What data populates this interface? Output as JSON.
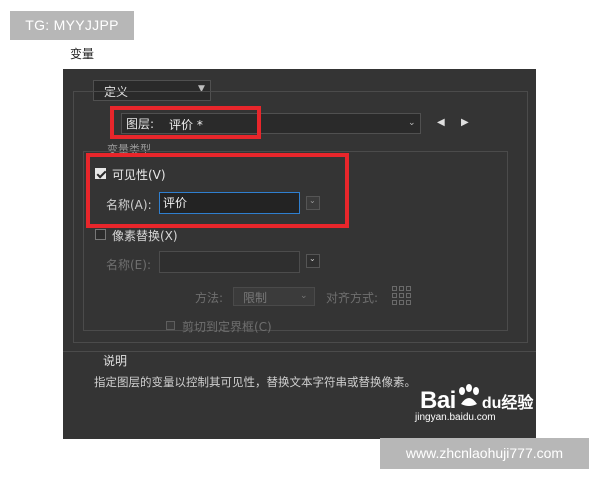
{
  "watermarks": {
    "top_left_tag": "TG: MYYJJPP",
    "baidu_text": "Bai",
    "baidu_text2": "du",
    "baidu_cn": "经验",
    "baidu_url": "jingyan.baidu.com",
    "site": "www.zhcnlaohuji777.com"
  },
  "page": {
    "title": "变量"
  },
  "dialog": {
    "define_select": {
      "value": "定义"
    },
    "layer": {
      "label": "图层:",
      "value": "评价 *"
    },
    "variable_type_label": "变量类型",
    "visibility": {
      "label": "可见性(V)",
      "checked": true,
      "name_label": "名称(A):",
      "name_value": "评价"
    },
    "pixel_replace": {
      "label": "像素替换(X)",
      "checked": false,
      "name_label": "名称(E):",
      "name_value": ""
    },
    "method": {
      "label": "方法:",
      "value": "限制",
      "align_label": "对齐方式:"
    },
    "clip": {
      "label": "剪切到定界框(C)",
      "checked": false
    },
    "description": {
      "header": "说明",
      "text": "指定图层的变量以控制其可见性，替换文本字符串或替换像素。"
    }
  },
  "colors": {
    "dialog_bg": "#343434",
    "highlight_red": "#e8262b",
    "focus_blue": "#2f7fcf",
    "badge_gray": "#b7b7b7"
  },
  "icons": [
    "chevron-down-icon",
    "arrow-left-icon",
    "arrow-right-icon",
    "checkbox-checked-icon",
    "align-grid-icon",
    "baidu-paw-icon"
  ]
}
